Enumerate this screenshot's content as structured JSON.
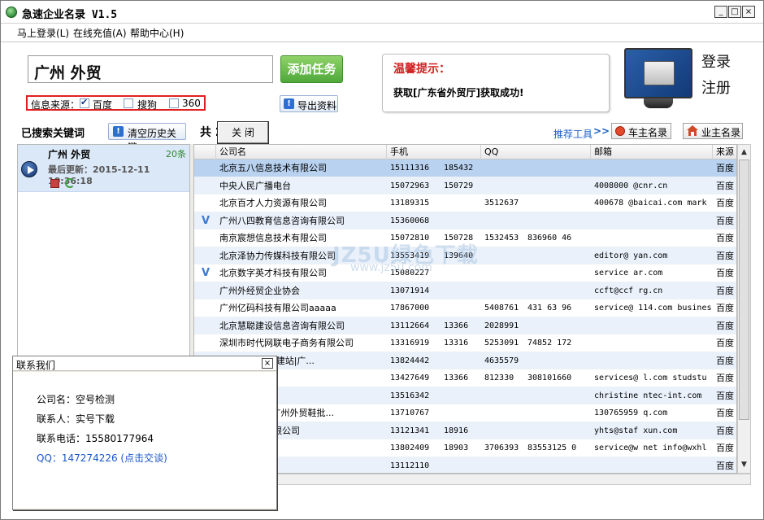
{
  "app": {
    "title": "急速企业名录 V1.5",
    "min": "_",
    "max": "□",
    "close": "×"
  },
  "menu": [
    {
      "label": "马上登录(L)"
    },
    {
      "label": "在线充值(A)"
    },
    {
      "label": "帮助中心(H)"
    }
  ],
  "search": {
    "value": "广州 外贸",
    "add_label": "添加任务",
    "source_label": "信息来源：",
    "sources": [
      {
        "label": "百度",
        "checked": true
      },
      {
        "label": "搜狗",
        "checked": false
      },
      {
        "label": "360",
        "checked": false
      }
    ],
    "export_label": "导出资料",
    "export_icon": "!"
  },
  "tip": {
    "title": "温馨提示：",
    "body": "获取[广东省外贸厅]获取成功!"
  },
  "account": {
    "login": "登录",
    "register": "注册"
  },
  "keywords": {
    "header": "已搜索关键词",
    "clear_label": "清空历史关键",
    "clear_icon": "!",
    "items": [
      {
        "name": "广州 外贸",
        "count": "20条",
        "updated": "最后更新：2015-12-11 10:36:18"
      }
    ]
  },
  "results": {
    "count_text": "共 20 条记录",
    "recommend": "推荐工具",
    "recommend_arrows": ">>",
    "car_label": "车主名录",
    "owner_label": "业主名录",
    "columns": [
      "公司名",
      "手机",
      "QQ",
      "邮箱",
      "来源"
    ],
    "rows": [
      {
        "v": "",
        "name": "北京五八信息技术有限公司",
        "phone": "15111316",
        "phone2": "185432",
        "qq": "",
        "qq2": "",
        "email": "",
        "src": "百度"
      },
      {
        "v": "",
        "name": "中央人民广播电台",
        "phone": "15072963",
        "phone2": "150729",
        "qq": "",
        "qq2": "",
        "email": "4008000   @cnr.cn",
        "src": "百度"
      },
      {
        "v": "",
        "name": "北京百才人力资源有限公司",
        "phone": "13189315",
        "phone2": "",
        "qq": "3512637",
        "qq2": "",
        "email": "400678   @baicai.com mark",
        "src": "百度"
      },
      {
        "v": "V",
        "name": "广州八四教育信息咨询有限公司",
        "phone": "15360068",
        "phone2": "",
        "qq": "",
        "qq2": "",
        "email": "",
        "src": "百度"
      },
      {
        "v": "",
        "name": "南京宸想信息技术有限公司",
        "phone": "15072810",
        "phone2": "150728",
        "qq": "1532453",
        "qq2": "836960     46",
        "email": "",
        "src": "百度"
      },
      {
        "v": "",
        "name": "北京泽协力传媒科技有限公司",
        "phone": "13553419",
        "phone2": "139640",
        "qq": "",
        "qq2": "",
        "email": "editor@    yan.com",
        "src": "百度"
      },
      {
        "v": "V",
        "name": "北京数字英才科技有限公司",
        "phone": "15080227",
        "phone2": "",
        "qq": "",
        "qq2": "",
        "email": "service    ar.com",
        "src": "百度"
      },
      {
        "v": "",
        "name": "广州外经贸企业协会",
        "phone": "13071914",
        "phone2": "",
        "qq": "",
        "qq2": "",
        "email": "ccft@ccf   rg.cn",
        "src": "百度"
      },
      {
        "v": "",
        "name": "广州亿码科技有限公司aaaaa",
        "phone": "17867000",
        "phone2": "",
        "qq": "5408761",
        "qq2": "431    63 96",
        "email": "service@   114.com busines",
        "src": "百度"
      },
      {
        "v": "",
        "name": "北京慧聪建设信息咨询有限公司",
        "phone": "13112664",
        "phone2": "13366",
        "qq": "2028991",
        "qq2": "",
        "email": "",
        "src": "百度"
      },
      {
        "v": "",
        "name": "深圳市时代网联电子商务有限公司",
        "phone": "13316919",
        "phone2": "13316",
        "qq": "5253091",
        "qq2": "74852  172",
        "email": "",
        "src": "百度"
      },
      {
        "v": "",
        "name": "建设|广州外贸建站|广...",
        "phone": "13824442",
        "phone2": "",
        "qq": "4635579",
        "qq2": "",
        "email": "",
        "src": "百度"
      },
      {
        "v": "",
        "name": "技有限公司",
        "phone": "13427649",
        "phone2": "13366",
        "qq": "812330",
        "qq2": "308101660",
        "email": "services@   l.com studstu",
        "src": "百度"
      },
      {
        "v": "",
        "name": "科技有限公司",
        "phone": "13516342",
        "phone2": "",
        "qq": "",
        "qq2": "",
        "email": "christine   ntec-int.com",
        "src": "百度"
      },
      {
        "v": "",
        "name": "MEEAOSEE)广州外贸鞋批...",
        "phone": "13710767",
        "phone2": "",
        "qq": "",
        "qq2": "",
        "email": "130765959   q.com",
        "src": "百度"
      },
      {
        "v": "",
        "name": "息咨询服务有限公司",
        "phone": "13121341",
        "phone2": "18916",
        "qq": "",
        "qq2": "",
        "email": "yhts@staf   xun.com",
        "src": "百度"
      },
      {
        "v": "",
        "name": "",
        "phone": "13802409",
        "phone2": "18903",
        "qq": "3706393",
        "qq2": "83553125    0",
        "email": "service@w    net info@wxhl",
        "src": "百度"
      },
      {
        "v": "",
        "name": "术有限公司",
        "phone": "13112110",
        "phone2": "",
        "qq": "",
        "qq2": "",
        "email": "",
        "src": "百度"
      }
    ],
    "sb_up": "▲",
    "sb_down": "▼"
  },
  "watermark": {
    "text": "JZ5U绿色下载",
    "url": "www.jz5u.com"
  },
  "dialog": {
    "title": "联系我们",
    "close": "×",
    "company": "公司名：空号检测",
    "contact": "联系人：实号下载",
    "phone": "联系电话：15580177964",
    "qq": "QQ：147274226 (点击交谈)",
    "close_button": "关  闭"
  },
  "colors": {
    "accent": "#1a5fc8",
    "add_button": "#4fa83a",
    "selected_row": "#b9d2f0",
    "alt_row": "#eaf1fb",
    "warning_title": "#d02020"
  }
}
